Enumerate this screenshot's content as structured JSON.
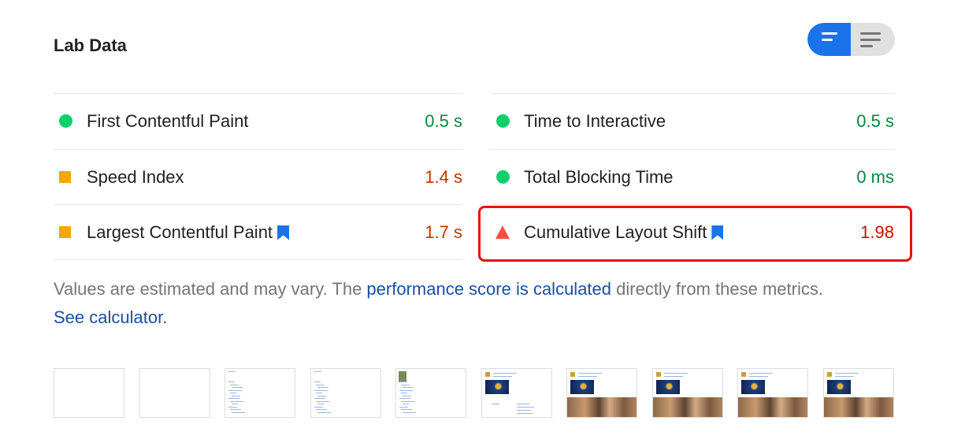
{
  "section": {
    "title": "Lab Data"
  },
  "view_toggle": {
    "active": "compact",
    "options": [
      "compact-view-icon",
      "list-view-icon"
    ],
    "accent": "#1a73e8"
  },
  "metrics_left": [
    {
      "label": "First Contentful Paint",
      "value": "0.5 s",
      "rating": "pass",
      "bookmark": false
    },
    {
      "label": "Speed Index",
      "value": "1.4 s",
      "rating": "average",
      "bookmark": false
    },
    {
      "label": "Largest Contentful Paint",
      "value": "1.7 s",
      "rating": "average",
      "bookmark": true
    }
  ],
  "metrics_right": [
    {
      "label": "Time to Interactive",
      "value": "0.5 s",
      "rating": "pass",
      "bookmark": false
    },
    {
      "label": "Total Blocking Time",
      "value": "0 ms",
      "rating": "pass",
      "bookmark": false
    },
    {
      "label": "Cumulative Layout Shift",
      "value": "1.98",
      "rating": "fail",
      "bookmark": true
    }
  ],
  "colors": {
    "pass": "#0cce6b",
    "average": "#ffa400",
    "fail": "#ff4e42",
    "highlight": "#e51313"
  },
  "note": {
    "text_before": "Values are estimated and may vary. The ",
    "link1": "performance score is calculated",
    "text_middle": " directly from these metrics. ",
    "link2": "See calculator."
  },
  "filmstrip": {
    "frame_count": 10
  }
}
